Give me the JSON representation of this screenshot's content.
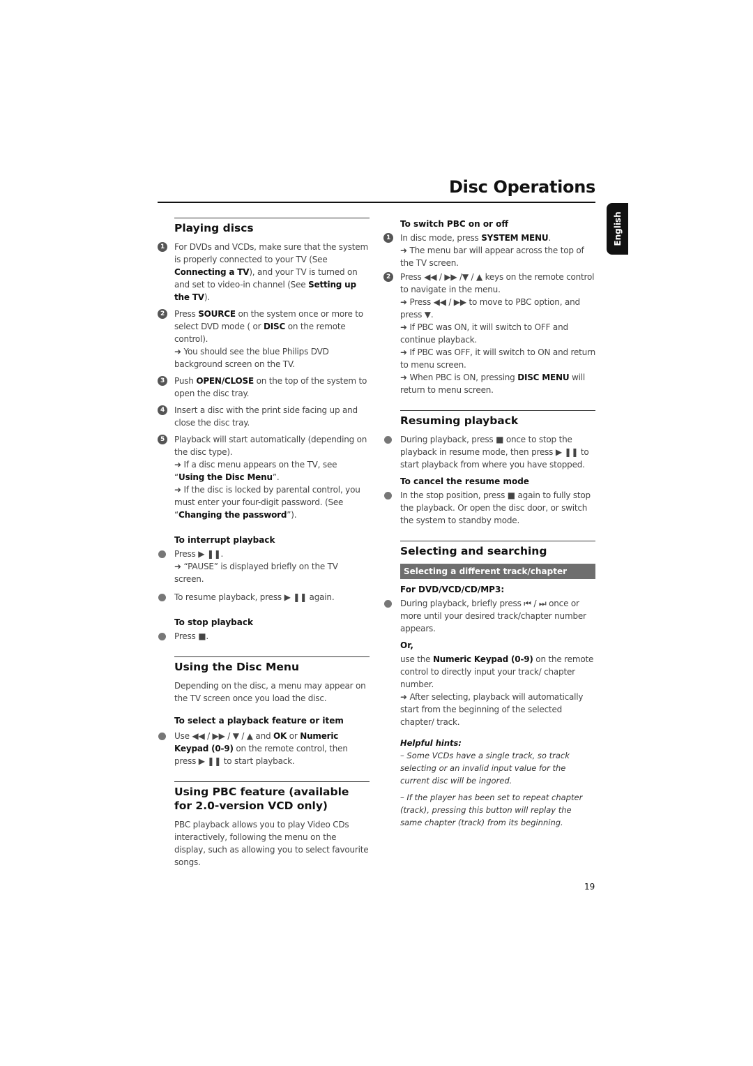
{
  "header": {
    "title": "Disc Operations",
    "language_tab": "English"
  },
  "left": {
    "playing_discs": {
      "heading": "Playing discs",
      "steps": [
        {
          "n": "1",
          "pre": "For DVDs and VCDs, make sure that the system is properly connected to your TV (See ",
          "b1": "Connecting a TV",
          "mid": "), and your TV is turned on and set to video-in channel (See ",
          "b2": "Setting up the TV",
          "post": ")."
        },
        {
          "n": "2",
          "pre": "Press ",
          "b1": "SOURCE",
          "mid": " on the system once or more to select DVD mode ( or ",
          "b2": "DISC",
          "post": " on the remote control).",
          "note": "➜ You should see the blue Philips DVD background screen on the TV."
        },
        {
          "n": "3",
          "pre": "Push ",
          "b1": "OPEN/CLOSE",
          "post": " on the top of the system to open the disc tray."
        },
        {
          "n": "4",
          "pre": "Insert a disc with the print side facing up and close the disc tray."
        },
        {
          "n": "5",
          "pre": "Playback will start automatically (depending on the disc type).",
          "note1_pre": "➜ If a disc menu appears on the TV, see “",
          "note1_b": "Using the Disc Menu",
          "note1_post": "”.",
          "note2_pre": "➜ If the disc is locked by parental control, you must enter your four-digit password. (See “",
          "note2_b": "Changing the password",
          "note2_post": "”)."
        }
      ],
      "interrupt": {
        "heading": "To interrupt playback",
        "line1": "Press ▶ ❚❚.",
        "note": "➜ “PAUSE” is displayed briefly on the TV screen.",
        "line2": "To resume playback, press  ▶ ❚❚ again."
      },
      "stop": {
        "heading": "To stop playback",
        "line": "Press ■."
      }
    },
    "disc_menu": {
      "heading": "Using the Disc Menu",
      "intro": "Depending on the disc, a menu may appear on the TV screen once you load the disc.",
      "sub": "To select a playback feature or item",
      "line_pre": "Use ◀◀ / ▶▶  /  ▼  /  ▲  and ",
      "b1": "OK",
      "mid": " or ",
      "b2": "Numeric Keypad (0-9)",
      "post": " on the remote control, then press ▶ ❚❚ to start playback."
    },
    "pbc": {
      "heading": "Using PBC feature (available for 2.0-version VCD only)",
      "intro": "PBC playback allows you to play Video CDs interactively, following the menu on the display, such as allowing you to select favourite songs."
    }
  },
  "right": {
    "pbc_switch": {
      "heading": "To switch PBC on or off",
      "step1_pre": " In disc mode, press ",
      "step1_b": "SYSTEM MENU",
      "step1_post": ".",
      "step1_note": "➜ The menu bar will appear across the top of the TV screen.",
      "step2": "Press ◀◀ / ▶▶  /▼  /  ▲  keys on the remote control to navigate in the menu.",
      "note_a": "➜ Press ◀◀ / ▶▶ to move to PBC option,  and press ▼.",
      "note_b": "➜ If PBC was ON, it will switch to OFF and continue playback.",
      "note_c": "➜ If PBC was OFF, it will switch to ON and return to menu screen.",
      "note_d_pre": "➜ When PBC is ON, pressing ",
      "note_d_b": "DISC MENU",
      "note_d_post": " will return to menu screen."
    },
    "resuming": {
      "heading": "Resuming playback",
      "line": "During playback, press ■ once to stop the playback in resume mode, then press ▶ ❚❚  to start playback from where you have stopped.",
      "sub": "To cancel the resume mode",
      "line2": "In the stop position, press ■ again to fully stop the playback. Or open the disc door, or switch the system to standby mode."
    },
    "selecting": {
      "heading": "Selecting and searching",
      "band": "Selecting a different track/chapter",
      "sub": "For DVD/VCD/CD/MP3:",
      "line": "During playback, briefly press ⏮ / ⏭  once or more until your desired track/chapter number appears.",
      "or": "Or,",
      "or_pre": "use the ",
      "or_b": "Numeric Keypad (0-9)",
      "or_post": " on the remote control to directly input your track/ chapter number.",
      "or_note": "➜ After selecting, playback will automatically start from the beginning of the selected chapter/ track.",
      "hints_heading": "Helpful hints:",
      "hint1": " –  Some VCDs have a single track,  so track selecting or an invalid input value for the current disc will be ingored.",
      "hint2": "–   If the player has been set to repeat chapter (track), pressing this button will replay the same chapter (track) from its beginning."
    }
  },
  "footer": {
    "page_number": "19"
  }
}
